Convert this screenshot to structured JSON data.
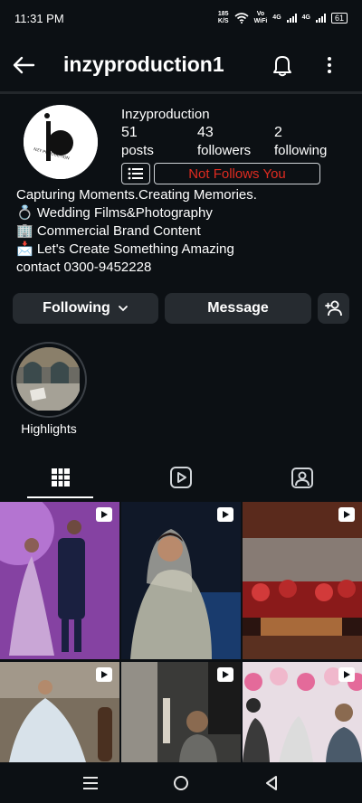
{
  "status_bar": {
    "time": "11:31 PM",
    "net_speed_top": "185",
    "net_speed_unit": "K/S",
    "volte_top": "Vo",
    "volte_bottom": "WiFi",
    "net_type_1": "4G",
    "net_type_2": "4G",
    "battery": "61"
  },
  "header": {
    "username": "inzyproduction1"
  },
  "profile": {
    "display_name": "Inzyproduction",
    "avatar_logo_text": "NZY PRODUCTION",
    "posts_count": "51",
    "posts_label": "posts",
    "followers_count": "43",
    "followers_label": "followers",
    "following_count": "2",
    "following_label": "following",
    "follow_status": "Not Follows You",
    "follow_status_color": "#e02b20"
  },
  "bio": {
    "lines": [
      "Capturing Moments.Creating Memories.",
      "💍 Wedding Films&Photography",
      "🏢 Commercial Brand Content",
      "📩 Let's Create Something Amazing",
      " contact 0300-9452228"
    ]
  },
  "actions": {
    "following_label": "Following",
    "message_label": "Message"
  },
  "highlights": [
    {
      "label": "Highlights"
    }
  ],
  "tabs": [
    {
      "icon": "grid-icon",
      "active": true
    },
    {
      "icon": "reels-icon",
      "active": false
    },
    {
      "icon": "tagged-icon",
      "active": false
    }
  ],
  "grid_posts": [
    {
      "description": "couple-purple-lights",
      "reel": true
    },
    {
      "description": "bride-portrait",
      "reel": true
    },
    {
      "description": "stage-flowers",
      "reel": true
    },
    {
      "description": "bride-white-gown",
      "reel": true
    },
    {
      "description": "photographers-at-event",
      "reel": true
    },
    {
      "description": "flower-wall-groom",
      "reel": true
    }
  ],
  "colors": {
    "background": "#0c1014",
    "button_bg": "#262b30",
    "text": "#f5f5f5"
  }
}
